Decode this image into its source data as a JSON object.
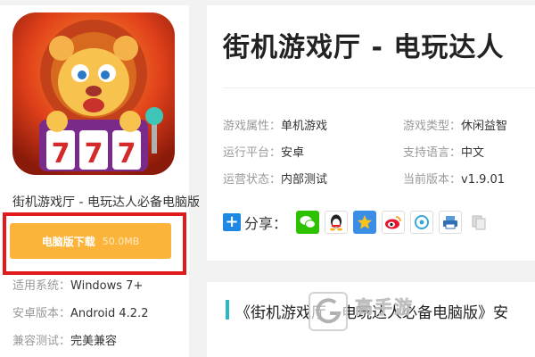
{
  "app": {
    "name": "街机游戏厅 - 电玩达人必备电脑版",
    "icon_name": "lion-777-slot-icon"
  },
  "download": {
    "label": "电脑版下载",
    "size": "50.0MB",
    "colors": {
      "button": "#fbb33a",
      "highlight_frame": "#e11b1b"
    }
  },
  "specs": [
    {
      "key": "适用系统：",
      "value": "Windows 7+"
    },
    {
      "key": "安卓版本：",
      "value": "Android 4.2.2"
    },
    {
      "key": "兼容测试：",
      "value": "完美兼容"
    }
  ],
  "main": {
    "title": "街机游戏厅 - 电玩达人",
    "attributes": [
      {
        "key": "游戏属性：",
        "value": "单机游戏"
      },
      {
        "key": "游戏类型：",
        "value": "休闲益智"
      },
      {
        "key": "运行平台：",
        "value": "安卓"
      },
      {
        "key": "支持语言：",
        "value": "中文"
      },
      {
        "key": "运营状态：",
        "value": "内部测试"
      },
      {
        "key": "当前版本：",
        "value": "v1.9.01"
      }
    ],
    "share": {
      "label": "分享：",
      "icons": [
        "wechat-icon",
        "qq-icon",
        "qzone-icon",
        "weibo-icon",
        "tencent-weibo-icon",
        "print-icon",
        "copy-icon"
      ]
    }
  },
  "article": {
    "title": "《街机游戏厅 - 电玩达人必备电脑版》安",
    "accent": "#2ab7c9"
  },
  "watermark": {
    "text": "高手游",
    "subtext": "GAOSHOUYOU.COM"
  }
}
